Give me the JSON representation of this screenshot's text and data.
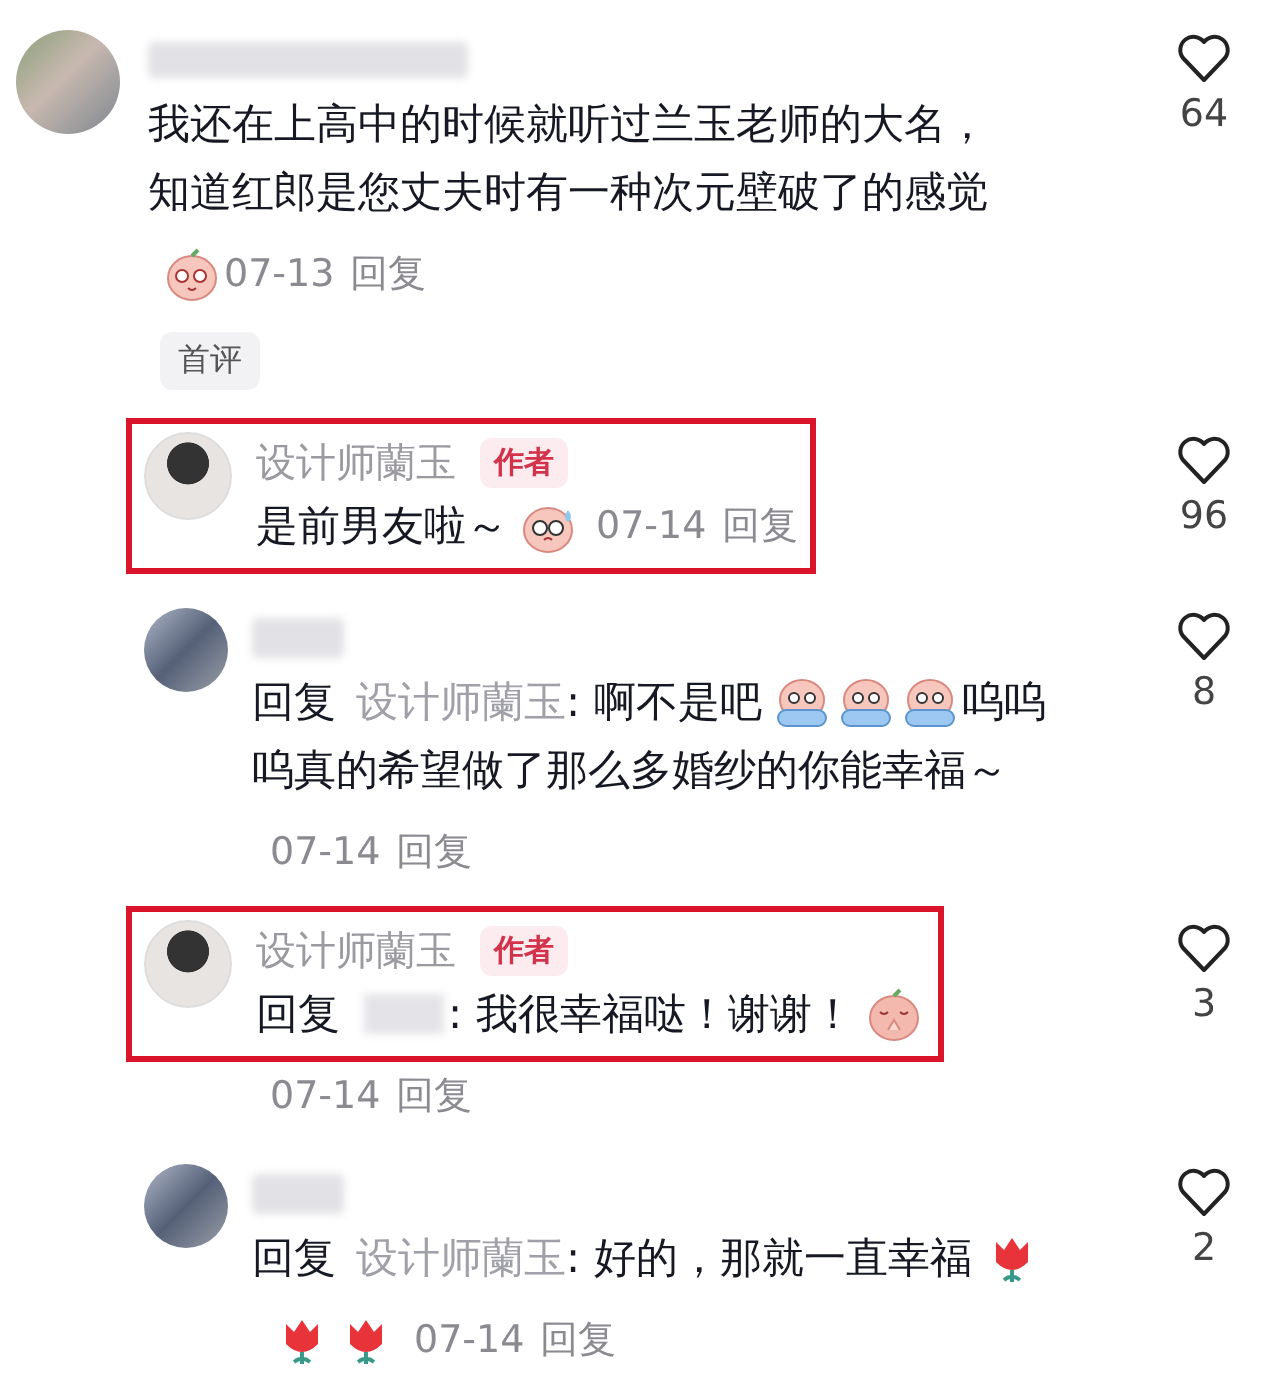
{
  "comments": [
    {
      "reply": false,
      "avatar": {
        "kind": "blurred"
      },
      "name_blurred": true,
      "highlighted": false,
      "likes": "64",
      "lines": [
        [
          {
            "kind": "text",
            "text": "我还在上高中的时候就听过兰玉老师的大名，"
          }
        ],
        [
          {
            "kind": "text",
            "text": "知道红郎是您丈夫时有一种次元壁破了的感觉"
          }
        ]
      ],
      "footer": [
        {
          "kind": "shy"
        },
        {
          "kind": "date",
          "text": "07-13"
        },
        {
          "kind": "action",
          "text": "回复"
        }
      ],
      "tag": "首评"
    },
    {
      "reply": true,
      "avatar": {
        "kind": "photo"
      },
      "name": "设计师蘭玉",
      "author_badge": "作者",
      "highlighted": true,
      "likes": "96",
      "lines": [
        [
          {
            "kind": "text",
            "text": "是前男友啦～"
          },
          {
            "kind": "sweat"
          },
          {
            "kind": "date",
            "text": "07-14"
          },
          {
            "kind": "action",
            "text": "回复"
          }
        ]
      ]
    },
    {
      "reply": true,
      "avatar": {
        "kind": "blurred"
      },
      "name_blurred": true,
      "highlighted": false,
      "likes": "8",
      "lines": [
        [
          {
            "kind": "text",
            "text": "回复"
          },
          {
            "kind": "mention",
            "text": "设计师蘭玉"
          },
          {
            "kind": "text",
            "text": ": 啊不是吧"
          },
          {
            "kind": "cry"
          },
          {
            "kind": "cry"
          },
          {
            "kind": "cry"
          },
          {
            "kind": "text",
            "text": "呜呜"
          }
        ],
        [
          {
            "kind": "text",
            "text": "呜真的希望做了那么多婚纱的你能幸福～"
          }
        ]
      ],
      "footer": [
        {
          "kind": "date",
          "text": "07-14"
        },
        {
          "kind": "action",
          "text": "回复"
        }
      ]
    },
    {
      "reply": true,
      "avatar": {
        "kind": "photo"
      },
      "name": "设计师蘭玉",
      "author_badge": "作者",
      "highlighted": true,
      "likes": "3",
      "lines": [
        [
          {
            "kind": "text",
            "text": "回复"
          },
          {
            "kind": "blurred"
          },
          {
            "kind": "text",
            "text": ": 我很幸福哒！谢谢！"
          },
          {
            "kind": "pray"
          }
        ]
      ],
      "footer": [
        {
          "kind": "date",
          "text": "07-14"
        },
        {
          "kind": "action",
          "text": "回复"
        }
      ]
    },
    {
      "reply": true,
      "avatar": {
        "kind": "blurred"
      },
      "name_blurred": true,
      "highlighted": false,
      "likes": "2",
      "lines": [
        [
          {
            "kind": "text",
            "text": "回复"
          },
          {
            "kind": "mention",
            "text": "设计师蘭玉"
          },
          {
            "kind": "text",
            "text": ": 好的，那就一直幸福"
          },
          {
            "kind": "rose"
          }
        ]
      ],
      "footer": [
        {
          "kind": "rose"
        },
        {
          "kind": "rose"
        },
        {
          "kind": "date",
          "text": "07-14"
        },
        {
          "kind": "action",
          "text": "回复"
        }
      ]
    }
  ]
}
